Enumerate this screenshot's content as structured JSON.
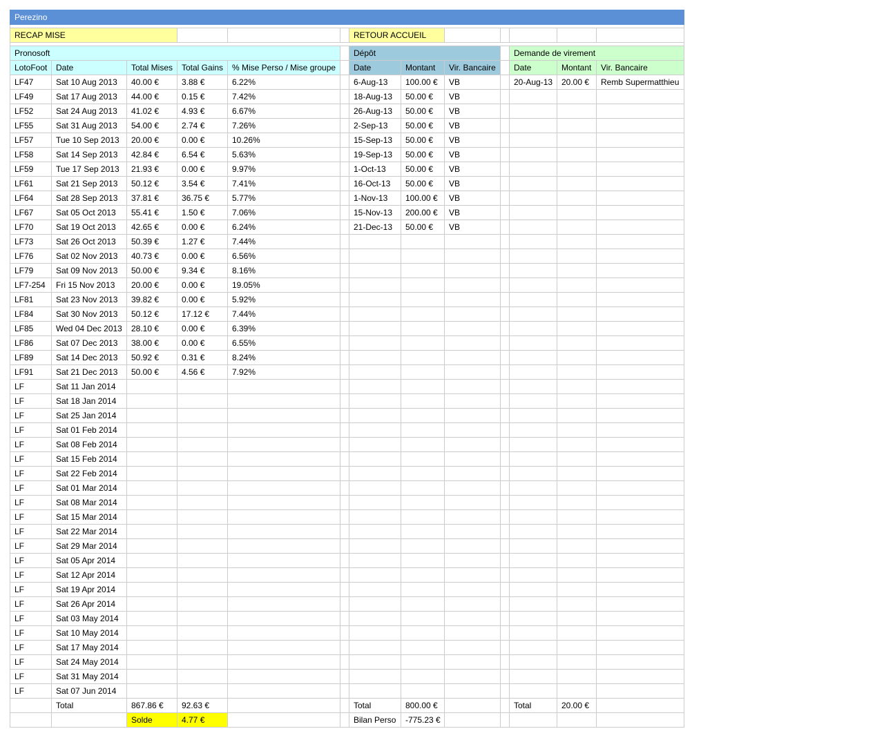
{
  "title": "Perezino",
  "nav": {
    "recap": "RECAP MISE",
    "retour": "RETOUR ACCUEIL"
  },
  "pronosoft": {
    "heading": "Pronosoft",
    "headers": [
      "LotoFoot",
      "Date",
      "Total Mises",
      "Total Gains",
      "% Mise Perso / Mise groupe"
    ],
    "rows": [
      [
        "LF47",
        "Sat 10 Aug 2013",
        "40.00 €",
        "3.88 €",
        "6.22%"
      ],
      [
        "LF49",
        "Sat 17 Aug 2013",
        "44.00 €",
        "0.15 €",
        "7.42%"
      ],
      [
        "LF52",
        "Sat 24 Aug 2013",
        "41.02 €",
        "4.93 €",
        "6.67%"
      ],
      [
        "LF55",
        "Sat 31 Aug 2013",
        "54.00 €",
        "2.74 €",
        "7.26%"
      ],
      [
        "LF57",
        "Tue 10 Sep 2013",
        "20.00 €",
        "0.00 €",
        "10.26%"
      ],
      [
        "LF58",
        "Sat 14 Sep 2013",
        "42.84 €",
        "6.54 €",
        "5.63%"
      ],
      [
        "LF59",
        "Tue 17 Sep 2013",
        "21.93 €",
        "0.00 €",
        "9.97%"
      ],
      [
        "LF61",
        "Sat 21 Sep 2013",
        "50.12 €",
        "3.54 €",
        "7.41%"
      ],
      [
        "LF64",
        "Sat 28 Sep 2013",
        "37.81 €",
        "36.75 €",
        "5.77%"
      ],
      [
        "LF67",
        "Sat 05 Oct 2013",
        "55.41 €",
        "1.50 €",
        "7.06%"
      ],
      [
        "LF70",
        "Sat 19 Oct 2013",
        "42.65 €",
        "0.00 €",
        "6.24%"
      ],
      [
        "LF73",
        "Sat 26 Oct 2013",
        "50.39 €",
        "1.27 €",
        "7.44%"
      ],
      [
        "LF76",
        "Sat 02 Nov 2013",
        "40.73 €",
        "0.00 €",
        "6.56%"
      ],
      [
        "LF79",
        "Sat 09 Nov 2013",
        "50.00 €",
        "9.34 €",
        "8.16%"
      ],
      [
        "LF7-254",
        "Fri 15 Nov 2013",
        "20.00 €",
        "0.00 €",
        "19.05%"
      ],
      [
        "LF81",
        "Sat 23 Nov 2013",
        "39.82 €",
        "0.00 €",
        "5.92%"
      ],
      [
        "LF84",
        "Sat 30 Nov 2013",
        "50.12 €",
        "17.12 €",
        "7.44%"
      ],
      [
        "LF85",
        "Wed 04 Dec 2013",
        "28.10 €",
        "0.00 €",
        "6.39%"
      ],
      [
        "LF86",
        "Sat 07 Dec 2013",
        "38.00 €",
        "0.00 €",
        "6.55%"
      ],
      [
        "LF89",
        "Sat 14 Dec 2013",
        "50.92 €",
        "0.31 €",
        "8.24%"
      ],
      [
        "LF91",
        "Sat 21 Dec 2013",
        "50.00 €",
        "4.56 €",
        "7.92%"
      ],
      [
        "LF",
        "Sat 11 Jan 2014",
        "",
        "",
        ""
      ],
      [
        "LF",
        "Sat 18 Jan 2014",
        "",
        "",
        ""
      ],
      [
        "LF",
        "Sat 25 Jan 2014",
        "",
        "",
        ""
      ],
      [
        "LF",
        "Sat 01 Feb 2014",
        "",
        "",
        ""
      ],
      [
        "LF",
        "Sat 08 Feb 2014",
        "",
        "",
        ""
      ],
      [
        "LF",
        "Sat 15 Feb 2014",
        "",
        "",
        ""
      ],
      [
        "LF",
        "Sat 22 Feb 2014",
        "",
        "",
        ""
      ],
      [
        "LF",
        "Sat 01 Mar 2014",
        "",
        "",
        ""
      ],
      [
        "LF",
        "Sat 08 Mar 2014",
        "",
        "",
        ""
      ],
      [
        "LF",
        "Sat 15 Mar 2014",
        "",
        "",
        ""
      ],
      [
        "LF",
        "Sat 22 Mar 2014",
        "",
        "",
        ""
      ],
      [
        "LF",
        "Sat 29 Mar 2014",
        "",
        "",
        ""
      ],
      [
        "LF",
        "Sat 05 Apr 2014",
        "",
        "",
        ""
      ],
      [
        "LF",
        "Sat 12 Apr 2014",
        "",
        "",
        ""
      ],
      [
        "LF",
        "Sat 19 Apr 2014",
        "",
        "",
        ""
      ],
      [
        "LF",
        "Sat 26 Apr 2014",
        "",
        "",
        ""
      ],
      [
        "LF",
        "Sat 03 May 2014",
        "",
        "",
        ""
      ],
      [
        "LF",
        "Sat 10 May 2014",
        "",
        "",
        ""
      ],
      [
        "LF",
        "Sat 17 May 2014",
        "",
        "",
        ""
      ],
      [
        "LF",
        "Sat 24 May 2014",
        "",
        "",
        ""
      ],
      [
        "LF",
        "Sat 31 May 2014",
        "",
        "",
        ""
      ],
      [
        "LF",
        "Sat 07 Jun 2014",
        "",
        "",
        ""
      ]
    ],
    "total_label": "Total",
    "total_mises": "867.86 €",
    "total_gains": "92.63 €",
    "solde_label": "Solde",
    "solde_value": "4.77 €"
  },
  "depot": {
    "heading": "Dépôt",
    "headers": [
      "Date",
      "Montant",
      "Vir. Bancaire"
    ],
    "rows": [
      [
        "6-Aug-13",
        "100.00 €",
        "VB"
      ],
      [
        "18-Aug-13",
        "50.00 €",
        "VB"
      ],
      [
        "26-Aug-13",
        "50.00 €",
        "VB"
      ],
      [
        "2-Sep-13",
        "50.00 €",
        "VB"
      ],
      [
        "15-Sep-13",
        "50.00 €",
        "VB"
      ],
      [
        "19-Sep-13",
        "50.00 €",
        "VB"
      ],
      [
        "1-Oct-13",
        "50.00 €",
        "VB"
      ],
      [
        "16-Oct-13",
        "50.00 €",
        "VB"
      ],
      [
        "1-Nov-13",
        "100.00 €",
        "VB"
      ],
      [
        "15-Nov-13",
        "200.00 €",
        "VB"
      ],
      [
        "21-Dec-13",
        "50.00 €",
        "VB"
      ]
    ],
    "total_label": "Total",
    "total_value": "800.00 €",
    "bilan_label": "Bilan Perso",
    "bilan_value": "-775.23 €"
  },
  "virement": {
    "heading": "Demande de virement",
    "headers": [
      "Date",
      "Montant",
      "Vir. Bancaire"
    ],
    "rows": [
      [
        "20-Aug-13",
        "20.00 €",
        "Remb Supermatthieu"
      ]
    ],
    "total_label": "Total",
    "total_value": "20.00 €"
  },
  "colors": {
    "title_bar": "#5b8fd6",
    "nav_yellow": "#ffff9d",
    "pronosoft_cyan": "#ccffff",
    "depot_teal": "#9dcbdd",
    "virement_green": "#ccffcc",
    "solde_yellow": "#ffff00"
  }
}
